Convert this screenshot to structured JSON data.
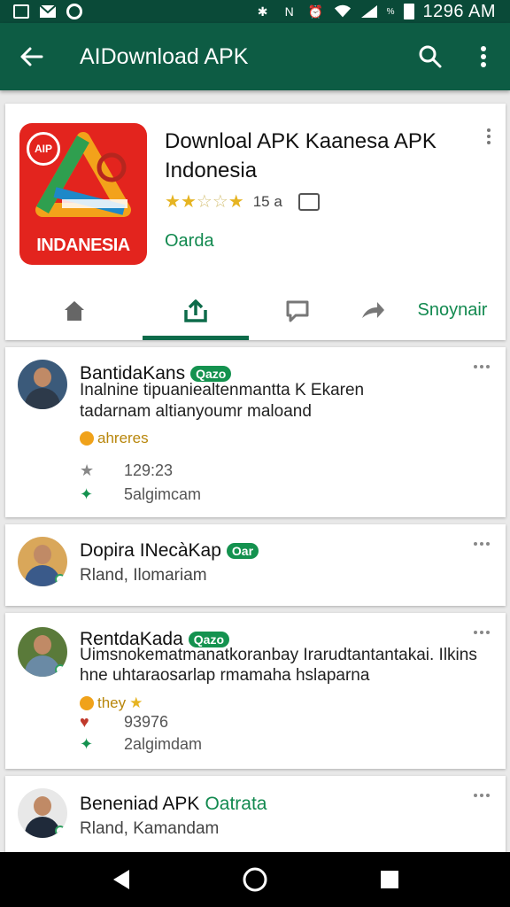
{
  "status_bar": {
    "time": "1296 AM",
    "battery_label": "%",
    "left_icons": [
      "image-icon",
      "mail-icon",
      "sync-icon"
    ],
    "right_icons": [
      "bluetooth-icon",
      "nfc-icon",
      "alarm-icon",
      "wifi-icon",
      "signal-icon",
      "battery-icon"
    ]
  },
  "app_bar": {
    "title": "AIDownload APK",
    "back_icon": "arrow-left-icon",
    "search_icon": "search-icon",
    "menu_icon": "more-vert-icon",
    "bg_color": "#0d5c44"
  },
  "app": {
    "title": "Downloal APK Kaanesa APK Indonesia",
    "icon_badge": "AIP",
    "icon_brand": "INDANESIA",
    "rating_stars": 2.5,
    "rating_count": "15 a",
    "developer": "Oarda",
    "accent_color": "#12894f"
  },
  "tabs": [
    {
      "icon": "home-icon",
      "label": ""
    },
    {
      "icon": "share-icon",
      "label": "",
      "active": true
    },
    {
      "icon": "comment-icon",
      "label": ""
    },
    {
      "icon": "forward-icon",
      "label": ""
    },
    {
      "icon": "",
      "label": "Snoynair"
    }
  ],
  "reviews": [
    {
      "name": "BantidaKans",
      "tag": "Qazo",
      "text_line1": "Inalnine tipuaniealtenmantta K Ekaren",
      "text_line2": "tadarnam altianyoumr maloand",
      "emoji_text": "ahreres",
      "meta1_value": "129:23",
      "meta2_value": "5algimcam"
    },
    {
      "name": "Dopira INecàKap",
      "tag": "Oar",
      "subtitle": "Rland, Ilomariam"
    },
    {
      "name": "RentdaKada",
      "tag": "Qazo",
      "text_line1": "Uimsnokematmanatkoranbay Irarudtantantakai. Ilkins",
      "text_line2": "hne uhtaraosarlap rmamaha hslaparna",
      "emoji_text": "they",
      "meta1_value": "93976",
      "meta2_value": "2algimdam"
    },
    {
      "name": "Beneniad APK",
      "tag_text": "Oatrata",
      "subtitle": "Rland, Kamandam"
    }
  ],
  "nav_bar": {
    "back_icon": "nav-back-icon",
    "home_icon": "nav-home-icon",
    "recents_icon": "nav-recents-icon"
  }
}
